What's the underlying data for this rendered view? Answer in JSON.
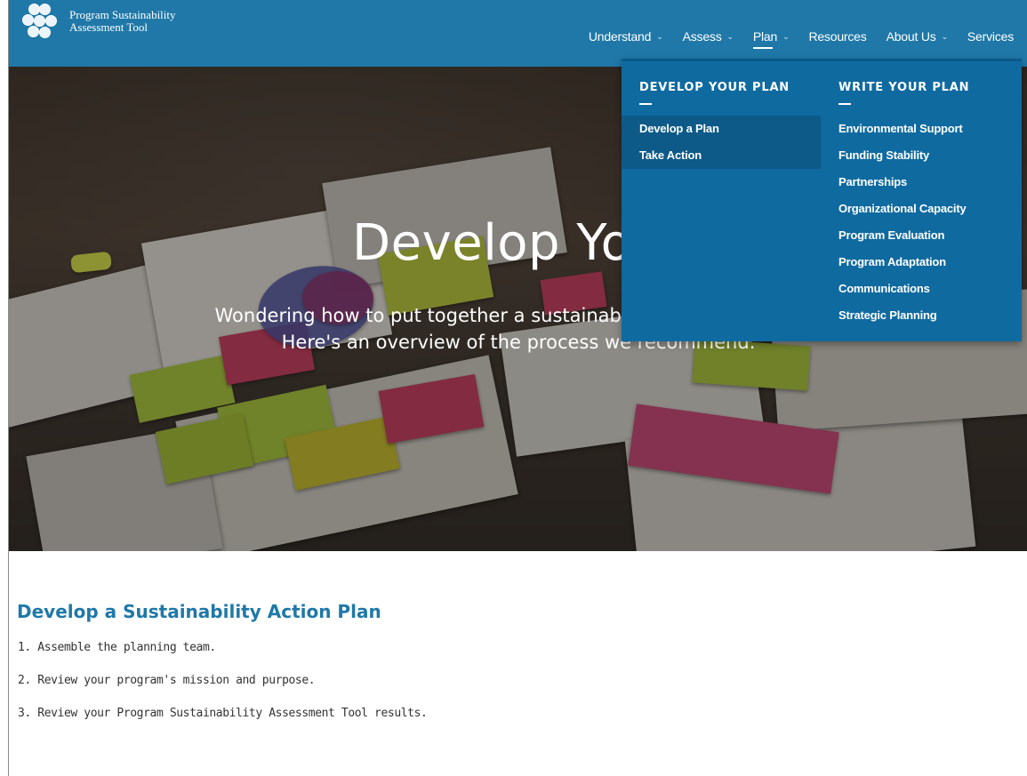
{
  "header": {
    "logo_line1": "Program Sustainability",
    "logo_line2": "Assessment Tool"
  },
  "nav": {
    "items": [
      {
        "label": "Understand",
        "dropdown": true
      },
      {
        "label": "Assess",
        "dropdown": true
      },
      {
        "label": "Plan",
        "dropdown": true,
        "active": true
      },
      {
        "label": "Resources",
        "dropdown": false
      },
      {
        "label": "About Us",
        "dropdown": true
      },
      {
        "label": "Services",
        "dropdown": false
      }
    ]
  },
  "mega_menu": {
    "develop": {
      "heading": "DEVELOP YOUR PLAN",
      "links": [
        "Develop a Plan",
        "Take Action"
      ]
    },
    "write": {
      "heading": "WRITE YOUR PLAN",
      "links": [
        "Environmental Support",
        "Funding Stability",
        "Partnerships",
        "Organizational Capacity",
        "Program Evaluation",
        "Program Adaptation",
        "Communications",
        "Strategic Planning"
      ]
    }
  },
  "hero": {
    "title": "Develop Your",
    "subtitle_line1": "Wondering how to put together a sustainabil",
    "subtitle_line2": "Here's an overview of the process we recommend."
  },
  "content": {
    "title": "Develop a Sustainability Action Plan",
    "steps": [
      "1. Assemble the planning team.",
      "2. Review your program's mission and purpose.",
      "3. Review your Program Sustainability Assessment Tool results."
    ]
  },
  "colors": {
    "header_bg": "#1f78a8",
    "menu_bg": "#0f6aa0",
    "accent_text": "#1f78a8"
  }
}
